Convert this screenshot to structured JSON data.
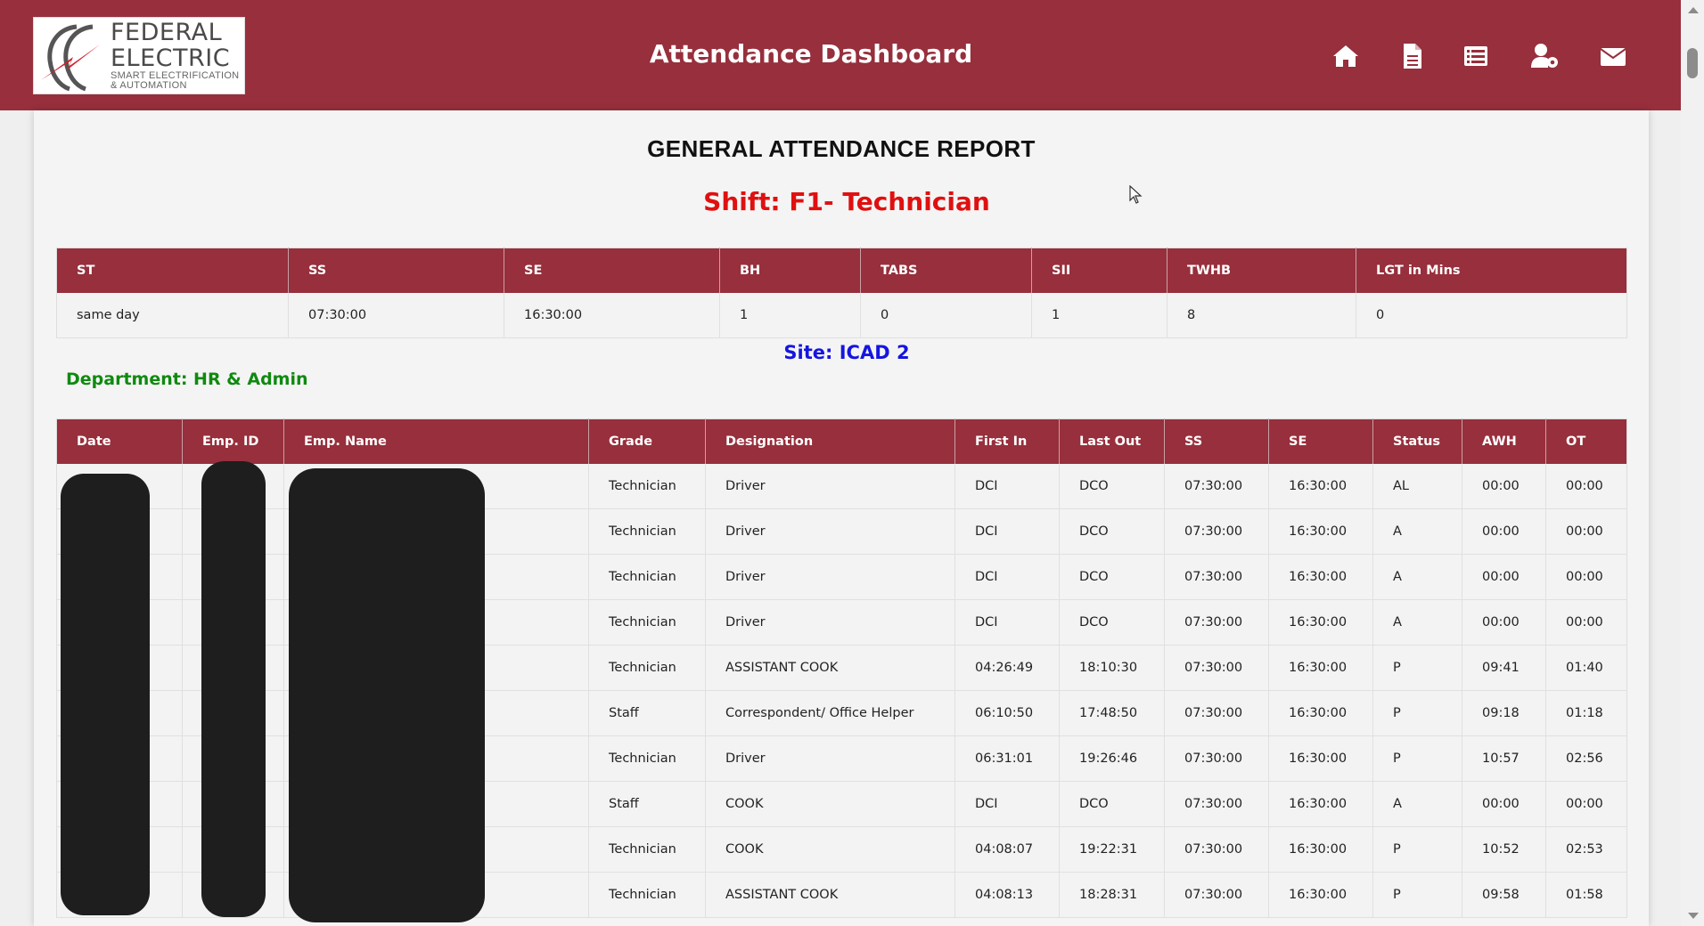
{
  "header": {
    "title": "Attendance Dashboard",
    "logo": {
      "line1": "FEDERAL",
      "line2": "ELECTRIC",
      "line3": "SMART ELECTRIFICATION",
      "line4": "& AUTOMATION"
    },
    "nav": [
      {
        "icon": "home-icon"
      },
      {
        "icon": "document-icon"
      },
      {
        "icon": "list-icon"
      },
      {
        "icon": "user-settings-icon"
      },
      {
        "icon": "envelope-icon"
      }
    ]
  },
  "report": {
    "title": "GENERAL ATTENDANCE REPORT",
    "shift": "Shift: F1- Technician",
    "site": "Site: ICAD 2",
    "department": "Department: HR & Admin"
  },
  "shift_table": {
    "headers": [
      "ST",
      "SS",
      "SE",
      "BH",
      "TABS",
      "SII",
      "TWHB",
      "LGT in Mins"
    ],
    "row": [
      "same day",
      "07:30:00",
      "16:30:00",
      "1",
      "0",
      "1",
      "8",
      "0"
    ]
  },
  "attendance_table": {
    "headers": [
      "Date",
      "Emp. ID",
      "Emp. Name",
      "Grade",
      "Designation",
      "First In",
      "Last Out",
      "SS",
      "SE",
      "Status",
      "AWH",
      "OT"
    ],
    "rows": [
      [
        "",
        "",
        "",
        "Technician",
        "Driver",
        "DCI",
        "DCO",
        "07:30:00",
        "16:30:00",
        "AL",
        "00:00",
        "00:00"
      ],
      [
        "",
        "",
        "",
        "Technician",
        "Driver",
        "DCI",
        "DCO",
        "07:30:00",
        "16:30:00",
        "A",
        "00:00",
        "00:00"
      ],
      [
        "",
        "",
        "",
        "Technician",
        "Driver",
        "DCI",
        "DCO",
        "07:30:00",
        "16:30:00",
        "A",
        "00:00",
        "00:00"
      ],
      [
        "",
        "",
        "",
        "Technician",
        "Driver",
        "DCI",
        "DCO",
        "07:30:00",
        "16:30:00",
        "A",
        "00:00",
        "00:00"
      ],
      [
        "",
        "",
        "",
        "Technician",
        "ASSISTANT COOK",
        "04:26:49",
        "18:10:30",
        "07:30:00",
        "16:30:00",
        "P",
        "09:41",
        "01:40"
      ],
      [
        "",
        "",
        "",
        "Staff",
        "Correspondent/ Office Helper",
        "06:10:50",
        "17:48:50",
        "07:30:00",
        "16:30:00",
        "P",
        "09:18",
        "01:18"
      ],
      [
        "",
        "",
        "",
        "Technician",
        "Driver",
        "06:31:01",
        "19:26:46",
        "07:30:00",
        "16:30:00",
        "P",
        "10:57",
        "02:56"
      ],
      [
        "",
        "",
        "",
        "Staff",
        "COOK",
        "DCI",
        "DCO",
        "07:30:00",
        "16:30:00",
        "A",
        "00:00",
        "00:00"
      ],
      [
        "",
        "",
        "",
        "Technician",
        "COOK",
        "04:08:07",
        "19:22:31",
        "07:30:00",
        "16:30:00",
        "P",
        "10:52",
        "02:53"
      ],
      [
        "",
        "",
        "",
        "Technician",
        "ASSISTANT COOK",
        "04:08:13",
        "18:28:31",
        "07:30:00",
        "16:30:00",
        "P",
        "09:58",
        "01:58"
      ]
    ]
  },
  "colors": {
    "brand": "#972f3c",
    "shift": "#e01010",
    "site": "#1515e0",
    "department": "#0f8a0f"
  }
}
